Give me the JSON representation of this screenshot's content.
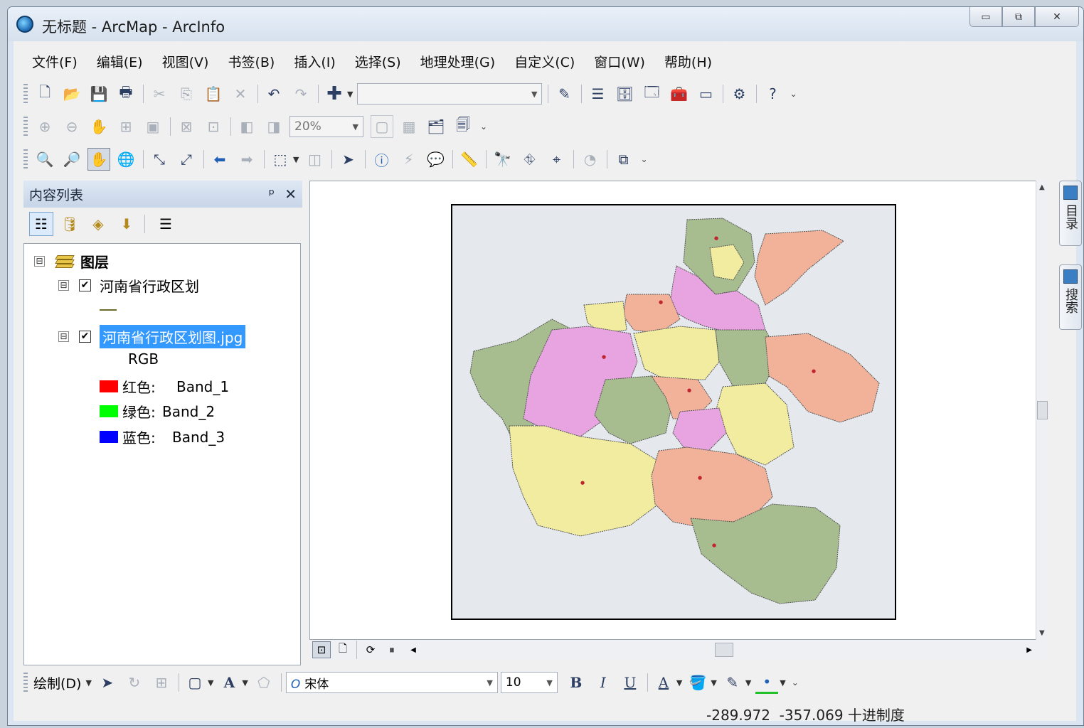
{
  "window": {
    "title": "无标题 - ArcMap - ArcInfo",
    "buttons": {
      "minimize": "▭",
      "maximize": "⧉",
      "close": "✕"
    }
  },
  "menu": [
    "文件(F)",
    "编辑(E)",
    "视图(V)",
    "书签(B)",
    "插入(I)",
    "选择(S)",
    "地理处理(G)",
    "自定义(C)",
    "窗口(W)",
    "帮助(H)"
  ],
  "toolbar_layout": {
    "zoom_value": "20%",
    "editor_combo_value": ""
  },
  "toc": {
    "title": "内容列表",
    "pin_glyph": "ᵖ",
    "close_glyph": "✕",
    "root": {
      "label": "图层",
      "expander": "⊟"
    },
    "layer1": {
      "label": "河南省行政区划",
      "checked": "✔",
      "expander": "⊟"
    },
    "layer2": {
      "label": "河南省行政区划图.jpg",
      "checked": "✔",
      "expander": "⊟",
      "renderer": "RGB",
      "bands": [
        {
          "color_label": "红色:",
          "band": "Band_1",
          "color": "#ff0000"
        },
        {
          "color_label": "绿色:",
          "band": "Band_2",
          "color": "#00ff00"
        },
        {
          "color_label": "蓝色:",
          "band": "Band_3",
          "color": "#0000ff"
        }
      ]
    }
  },
  "side_tabs": [
    "目录",
    "搜索"
  ],
  "draw_toolbar": {
    "draw_label": "绘制(D)",
    "font": "宋体",
    "font_size": "10",
    "bold": "B",
    "italic": "I",
    "underline": "U",
    "font_color": "A"
  },
  "status": {
    "x": "-289.972",
    "y": "-357.069",
    "units": "十进制度"
  },
  "map_colors": {
    "green": "#a7bd8f",
    "pink": "#e7a4e0",
    "yellow": "#f1ec9f",
    "salmon": "#f2b29a",
    "background": "#e5e9ee"
  }
}
